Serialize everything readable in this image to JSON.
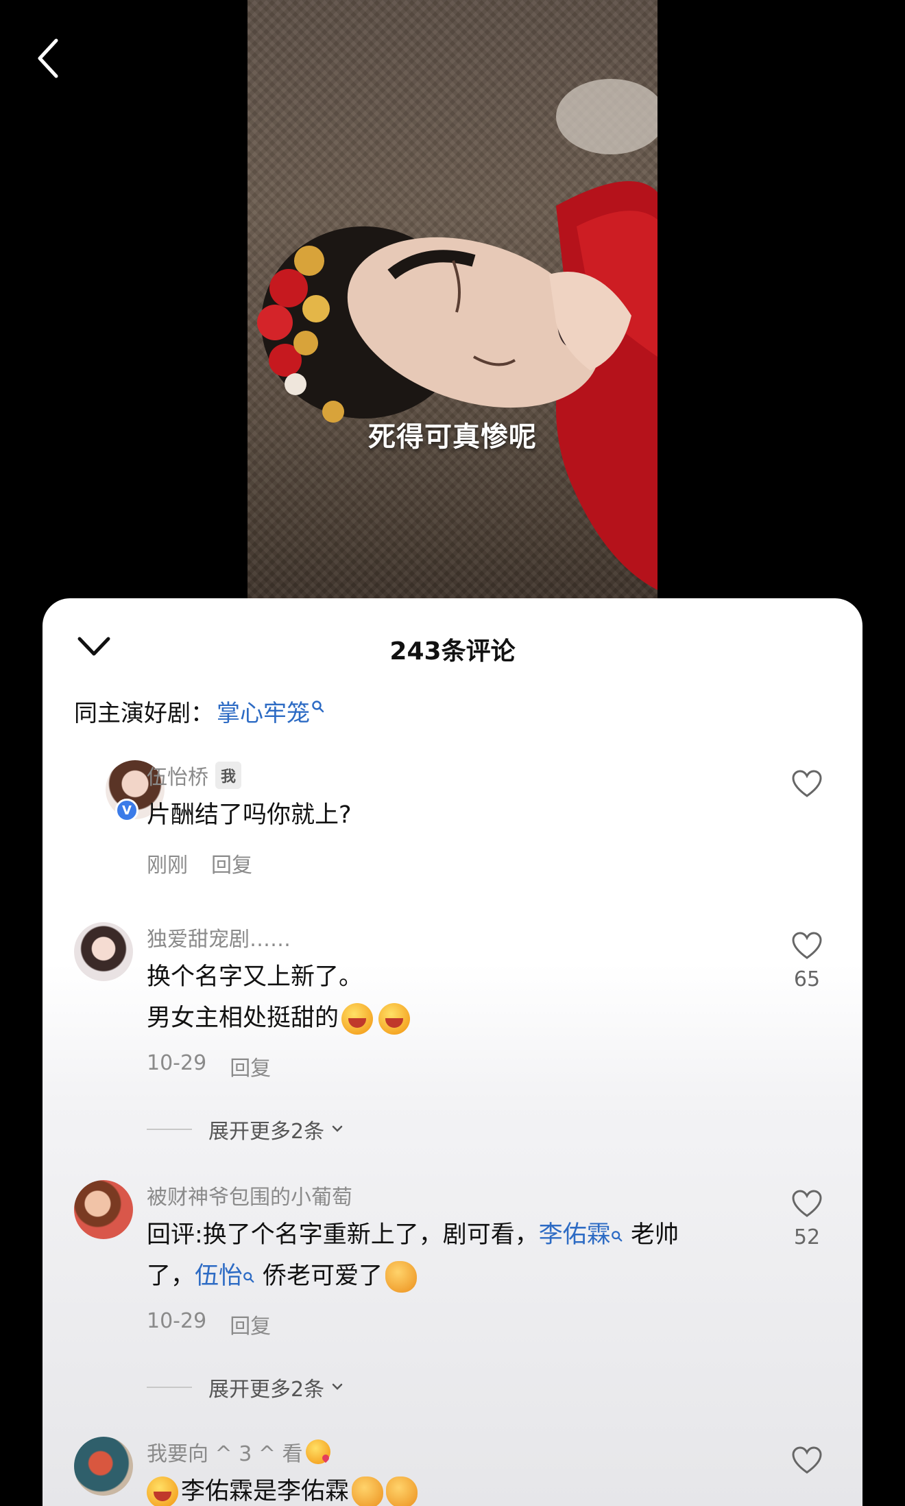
{
  "video": {
    "subtitle": "死得可真惨呢"
  },
  "comments_panel": {
    "title": "243条评论",
    "related_prefix": "同主演好剧：",
    "related_link": "掌心牢笼"
  },
  "comments": [
    {
      "username": "伍怡桥",
      "badge": "我",
      "text": "片酬结了吗你就上?",
      "time": "刚刚",
      "reply_label": "回复",
      "likes": ""
    },
    {
      "username": "独爱甜宠剧……",
      "text_line1": "换个名字又上新了。",
      "text_line2": "男女主相处挺甜的",
      "time": "10-29",
      "reply_label": "回复",
      "likes": "65",
      "expand_label": "展开更多2条"
    },
    {
      "username": "被财神爷包围的小葡萄",
      "text_a": "回评:换了个名字重新上了，剧可看，",
      "link_a": "李佑霖",
      "text_b": " 老帅",
      "text_c": "了，",
      "link_b": "伍怡",
      "text_d": " 侨老可爱了",
      "time": "10-29",
      "reply_label": "回复",
      "likes": "52",
      "expand_label": "展开更多2条"
    },
    {
      "username": "我要向 ^ 3 ^ 看",
      "text": "李佑霖是李佑霖"
    }
  ]
}
